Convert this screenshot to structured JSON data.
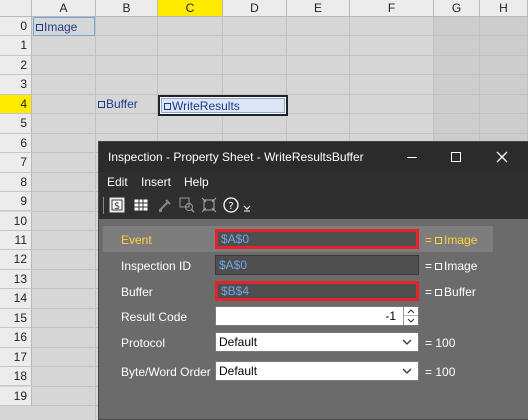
{
  "sheet": {
    "columns": [
      "A",
      "B",
      "C",
      "D",
      "E",
      "F",
      "G",
      "H"
    ],
    "rows": [
      "0",
      "1",
      "2",
      "3",
      "4",
      "5",
      "6",
      "7",
      "8",
      "9",
      "10",
      "11",
      "12",
      "13",
      "14",
      "15",
      "16",
      "17",
      "18",
      "19"
    ],
    "selected_column": "C",
    "selected_row": "4",
    "cells": {
      "A0": "Image",
      "B4": "Buffer",
      "C4": "WriteResults"
    }
  },
  "dialog": {
    "title": "Inspection - Property Sheet - WriteResultsBuffer",
    "menu": [
      "Edit",
      "Insert",
      "Help"
    ],
    "toolbar_icons": [
      "properties-icon",
      "table-icon",
      "pick-icon",
      "zoom-icon",
      "fit-icon",
      "help-icon",
      "more-icon"
    ],
    "properties": [
      {
        "label": "Event",
        "value": "$A$0",
        "result": "Image",
        "type": "text",
        "highlight": true,
        "active": true
      },
      {
        "label": "Inspection ID",
        "value": "$A$0",
        "result": "Image",
        "type": "text",
        "highlight": false,
        "active": false
      },
      {
        "label": "Buffer",
        "value": "$B$4",
        "result": "Buffer",
        "type": "text",
        "highlight": true,
        "active": false
      },
      {
        "label": "Result Code",
        "value": "-1",
        "result": "",
        "type": "spin",
        "highlight": false,
        "active": false
      },
      {
        "label": "Protocol",
        "value": "Default",
        "result": "100",
        "type": "select",
        "highlight": false,
        "active": false
      },
      {
        "label": "Byte/Word Order",
        "value": "Default",
        "result": "100",
        "type": "select",
        "highlight": false,
        "active": false
      }
    ]
  },
  "colors": {
    "selection_header": "#ffeb00",
    "highlight_border": "#e3242b",
    "active_label": "#ffd23a",
    "reference_text": "#6fa5ea",
    "cell_text": "#1e3a8a"
  }
}
